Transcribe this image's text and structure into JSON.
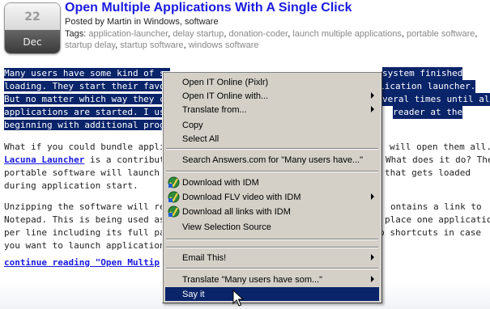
{
  "date": {
    "day": "22",
    "month": "Dec"
  },
  "post": {
    "title": "Open Multiple Applications With A Single Click",
    "meta_prefix": "Posted by ",
    "author": "Martin",
    "meta_in": " in ",
    "category_1": "Windows",
    "meta_comma": ", ",
    "category_2": "software",
    "tags_label": "Tags: ",
    "tags": [
      "application-launcher",
      "delay startup",
      "donation-coder",
      "launch multiple applications",
      "portable software",
      "startup delay",
      "startup software",
      "windows software"
    ]
  },
  "body": {
    "para1_lines": [
      "Many users have some kind of se",
      "loading. They start their favorite a",
      "But no matter which way they cho",
      "applications are started. I usually",
      "beginning with additional program"
    ],
    "para1_right": [
      "system finished",
      "n application launcher.",
      "veral times until all",
      "reader at the",
      ""
    ],
    "para2_line1_left": "What if you could bundle applicati",
    "para2_line1_right": "will open them all.",
    "para2_line2_link": "Lacuna Launcher",
    "para2_line2_mid": " is a contributio",
    "para2_line2_right": "What does it do? The",
    "para2_line3_left": "portable software will launch all ap",
    "para2_line3_right": "that gets loaded",
    "para2_line4": "during application start.",
    "para3_line1_left": "Unzipping the software will reveal",
    "para3_line1_right": "ontains a link to",
    "para3_line2_left": "Notepad. This is being used as an",
    "para3_line2_right": "place one application",
    "para3_line3_left": "per line including its full path in the",
    "para3_line3_right": "ion to shortcuts in case",
    "para3_line4_left": "you want to launch applications wit",
    "continue_link": "continue reading \"Open Multip"
  },
  "context_menu": {
    "items": [
      {
        "label": "Open IT Online (Pixlr)",
        "submenu": false,
        "icon": ""
      },
      {
        "label": "Open IT Online with...",
        "submenu": true,
        "icon": ""
      },
      {
        "label": "Translate from...",
        "submenu": true,
        "icon": ""
      },
      {
        "label": "Copy",
        "submenu": false,
        "icon": ""
      },
      {
        "label": "Select All",
        "submenu": false,
        "icon": ""
      },
      {
        "label": "Search Answers.com for \"Many users have...\"",
        "submenu": false,
        "icon": ""
      },
      {
        "label": "Download with IDM",
        "submenu": false,
        "icon": "idm-icon"
      },
      {
        "label": "Download FLV video with IDM",
        "submenu": true,
        "icon": "idm-icon"
      },
      {
        "label": "Download all links with IDM",
        "submenu": false,
        "icon": "idm-icon"
      },
      {
        "label": "View Selection Source",
        "submenu": false,
        "icon": ""
      },
      {
        "label": "Email This!",
        "submenu": true,
        "icon": ""
      },
      {
        "label": "Translate \"Many users have som...\"",
        "submenu": true,
        "icon": ""
      },
      {
        "label": "Say it",
        "submenu": false,
        "icon": "",
        "selected": true
      }
    ]
  },
  "colors": {
    "selection": "#0a246a",
    "link": "#1a1ae0",
    "menu_bg": "#d4d0c8",
    "tag": "#888888"
  }
}
